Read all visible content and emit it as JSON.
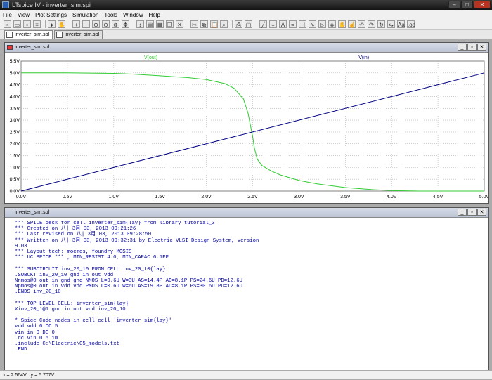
{
  "window": {
    "title": "LTspice IV - inverter_sim.spi"
  },
  "menu": [
    "File",
    "View",
    "Plot Settings",
    "Simulation",
    "Tools",
    "Window",
    "Help"
  ],
  "toolbar_icons": [
    "new-icon",
    "open-icon",
    "save-icon",
    "control-panel-icon",
    "sep",
    "run-icon",
    "halt-icon",
    "sep",
    "zoom-in-icon",
    "zoom-out-icon",
    "zoom-area-icon",
    "zoom-fit-icon",
    "zoom-cancel-icon",
    "pan-icon",
    "sep",
    "autorange-icon",
    "split-icon",
    "tile-icon",
    "cascade-icon",
    "close-window-icon",
    "sep",
    "cut-icon",
    "copy-icon",
    "paste-icon",
    "find-icon",
    "sep",
    "print-icon",
    "print-preview-icon",
    "sep",
    "wire-icon",
    "ground-icon",
    "label-icon",
    "resistor-icon",
    "capacitor-icon",
    "inductor-icon",
    "diode-icon",
    "component-icon",
    "move-icon",
    "drag-icon",
    "undo-icon",
    "redo-icon",
    "rotate-icon",
    "mirror-icon",
    "text-icon",
    "spice-directive-icon"
  ],
  "tabs": [
    {
      "label": "inverter_sim.spl"
    },
    {
      "label": "inverter_sim.spl"
    }
  ],
  "plot_window": {
    "title": "inverter_sim.spl"
  },
  "netlist_window": {
    "title": "inverter_sim.spl"
  },
  "colors": {
    "vout": "#33cc33",
    "vin": "#000080",
    "grid": "#b0b0b0"
  },
  "chart_data": {
    "type": "line",
    "xlim": [
      0,
      5
    ],
    "ylim": [
      0,
      5.5
    ],
    "x_ticks": [
      "0.0V",
      "0.5V",
      "1.0V",
      "1.5V",
      "2.0V",
      "2.5V",
      "3.0V",
      "3.5V",
      "4.0V",
      "4.5V",
      "5.0V"
    ],
    "y_ticks": [
      "0.0V",
      "0.5V",
      "1.0V",
      "1.5V",
      "2.0V",
      "2.5V",
      "3.0V",
      "3.5V",
      "4.0V",
      "4.5V",
      "5.0V",
      "5.5V"
    ],
    "grid": true,
    "series": [
      {
        "name": "V(out)",
        "color": "#33cc33",
        "x": [
          0,
          0.5,
          1.0,
          1.2,
          1.5,
          1.8,
          2.0,
          2.2,
          2.3,
          2.4,
          2.45,
          2.5,
          2.52,
          2.55,
          2.6,
          2.7,
          2.8,
          3.0,
          3.2,
          3.5,
          3.8,
          4.0,
          4.3,
          4.6,
          5.0
        ],
        "y": [
          5.0,
          5.0,
          4.98,
          4.95,
          4.88,
          4.8,
          4.72,
          4.55,
          4.35,
          3.9,
          3.3,
          2.3,
          1.8,
          1.35,
          1.08,
          0.85,
          0.68,
          0.45,
          0.3,
          0.15,
          0.06,
          0.02,
          0.0,
          0.0,
          0.0
        ]
      },
      {
        "name": "V(in)",
        "color": "#000080",
        "x": [
          0,
          5.0
        ],
        "y": [
          0,
          5.0
        ]
      }
    ]
  },
  "netlist_lines": [
    "*** SPICE deck for cell inverter_sim{lay} from library tutorial_3",
    "*** Created on 八| 3月 03, 2013 09:21:26",
    "*** Last revised on 八| 3月 03, 2013 09:28:50",
    "*** Written on 八| 3月 03, 2013 09:32:31 by Electric VLSI Design System, version",
    "9.03",
    "*** Layout tech: mocmos, foundry MOSIS",
    "*** UC SPICE *** , MIN_RESIST 4.0, MIN_CAPAC 0.1FF",
    "",
    "*** SUBCIRCUIT inv_20_10 FROM CELL inv_20_10{lay}",
    ".SUBCKT inv_20_10 gnd in out vdd",
    "Nnmos@0 out in gnd gnd NMOS L=0.6U W=3U AS=14.4P AD=8.1P PS=24.6U PD=12.6U",
    "Npmos@0 out in vdd vdd PMOS L=0.6U W=6U AS=19.8P AD=8.1P PS=30.6U PD=12.6U",
    ".ENDS inv_20_10",
    "",
    "*** TOP LEVEL CELL: inverter_sim{lay}",
    "Xinv_20_1@1 gnd in out vdd inv_20_10",
    "",
    "* Spice Code nodes in cell cell 'inverter_sim{lay}'",
    "vdd vdd 0 DC 5",
    "vin in 0 DC 0",
    ".dc vin 0 5 1m",
    ".include C:\\Electric\\C5_models.txt",
    ".END"
  ],
  "status": {
    "x": "x = 2.564V",
    "y": "y = 5.707V"
  }
}
